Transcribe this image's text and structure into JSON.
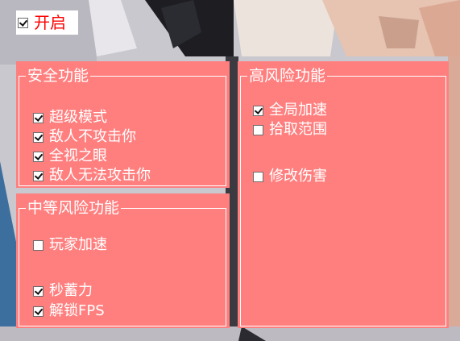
{
  "master_toggle": {
    "label": "开启",
    "checked": true
  },
  "groups": {
    "safe": {
      "title": "安全功能",
      "options": [
        {
          "label": "超级模式",
          "checked": true
        },
        {
          "label": "敌人不攻击你",
          "checked": true
        },
        {
          "label": "全视之眼",
          "checked": true
        },
        {
          "label": "敌人无法攻击你",
          "checked": true
        }
      ]
    },
    "medium": {
      "title": "中等风险功能",
      "options": [
        {
          "label": "玩家加速",
          "checked": false
        },
        {
          "label": "秒蓄力",
          "checked": true
        },
        {
          "label": "解锁FPS",
          "checked": true
        }
      ]
    },
    "high": {
      "title": "高风险功能",
      "options": [
        {
          "label": "全局加速",
          "checked": true
        },
        {
          "label": "拾取范围",
          "checked": false
        },
        {
          "label": "修改伤害",
          "checked": false
        }
      ]
    }
  },
  "colors": {
    "panel": "#ff7f7f",
    "text": "#ffffff",
    "master_label": "#ff0000"
  }
}
